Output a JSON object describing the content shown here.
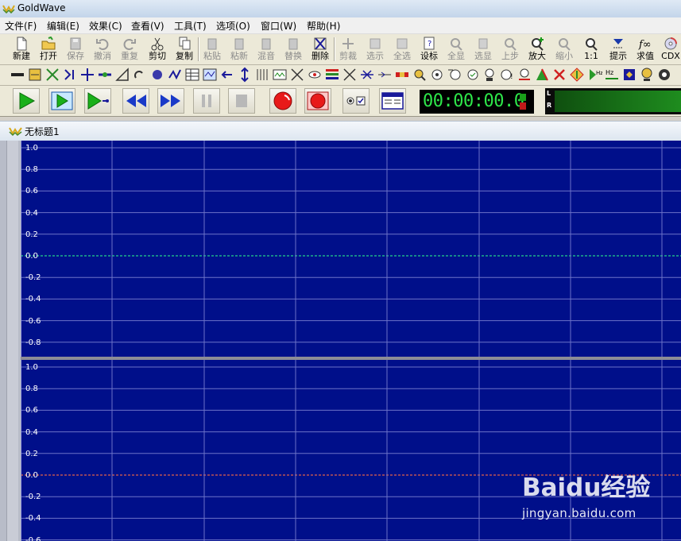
{
  "window": {
    "title": "GoldWave"
  },
  "menu": [
    "文件(F)",
    "编辑(E)",
    "效果(C)",
    "查看(V)",
    "工具(T)",
    "选项(O)",
    "窗口(W)",
    "帮助(H)"
  ],
  "toolbar": {
    "new": "新建",
    "open": "打开",
    "save": "保存",
    "undo": "撤消",
    "redo": "重复",
    "cut": "剪切",
    "copy": "复制",
    "paste": "粘贴",
    "paste_new": "粘新",
    "mix": "混音",
    "replace": "替换",
    "delete": "删除",
    "trim": "剪裁",
    "show_sel": "选示",
    "select_all": "全选",
    "set_marker": "设标",
    "view_all": "全显",
    "view_sel": "选显",
    "prev": "上步",
    "zoom_in": "放大",
    "zoom_out": "缩小",
    "zoom_1to1": "1:1",
    "cue": "提示",
    "eval": "求值",
    "cdx": "CDX"
  },
  "transport": {
    "time": "00:00:00.0",
    "meter_left": "L",
    "meter_right": "R"
  },
  "document": {
    "title": "无标题1"
  },
  "channel_left": {
    "ticks": [
      "1.0",
      "0.8",
      "0.6",
      "0.4",
      "0.2",
      "0.0",
      "-0.2",
      "-0.4",
      "-0.6",
      "-0.8"
    ],
    "line_color": "#22d08a"
  },
  "channel_right": {
    "ticks": [
      "1.0",
      "0.8",
      "0.6",
      "0.4",
      "0.2",
      "0.0",
      "-0.2",
      "-0.4",
      "-0.6"
    ],
    "line_color": "#e0604a"
  },
  "colors": {
    "wave_bg": "#000f8a",
    "grid": "#6c72c8",
    "timer_digits": "#2ee64a"
  },
  "watermark": {
    "logo": "Baidu经验",
    "url": "jingyan.baidu.com"
  }
}
